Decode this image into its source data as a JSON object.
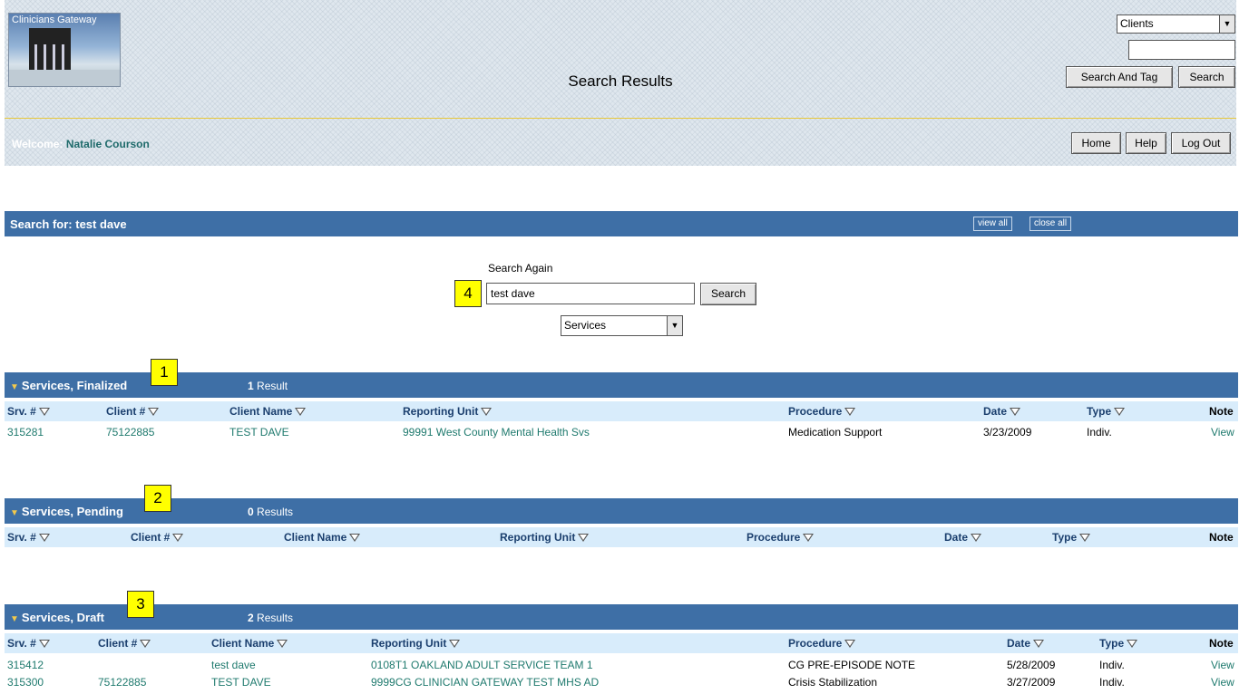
{
  "header": {
    "logo_text": "Clinicians Gateway",
    "page_title": "Search Results",
    "search_type_value": "Clients",
    "quick_search_value": "",
    "search_and_tag_label": "Search And Tag",
    "search_label": "Search",
    "welcome_label": "Welcome:",
    "user_name": "Natalie Courson",
    "home_label": "Home",
    "help_label": "Help",
    "logout_label": "Log Out"
  },
  "search_bar": {
    "title": "Search for: test dave",
    "view_all": "view all",
    "close_all": "close all"
  },
  "search_again": {
    "label": "Search Again",
    "value": "test dave",
    "button": "Search",
    "category": "Services"
  },
  "callouts": [
    "1",
    "2",
    "3",
    "4"
  ],
  "sections": [
    {
      "title": "Services, Finalized",
      "count": "1",
      "count_label": "Result",
      "columns": [
        "Srv. #",
        "Client #",
        "Client Name",
        "Reporting Unit",
        "Procedure",
        "Date",
        "Type",
        "Note"
      ],
      "rows": [
        [
          "315281",
          "75122885",
          "TEST DAVE",
          "99991 West County Mental Health Svs",
          "Medication Support",
          "3/23/2009",
          "Indiv.",
          "View"
        ]
      ]
    },
    {
      "title": "Services, Pending",
      "count": "0",
      "count_label": "Results",
      "columns": [
        "Srv. #",
        "Client #",
        "Client Name",
        "Reporting Unit",
        "Procedure",
        "Date",
        "Type",
        "Note"
      ],
      "rows": []
    },
    {
      "title": "Services, Draft",
      "count": "2",
      "count_label": "Results",
      "columns": [
        "Srv. #",
        "Client #",
        "Client Name",
        "Reporting Unit",
        "Procedure",
        "Date",
        "Type",
        "Note"
      ],
      "rows": [
        [
          "315412",
          "",
          "test dave",
          "0108T1 OAKLAND ADULT SERVICE TEAM 1",
          "CG PRE-EPISODE NOTE",
          "5/28/2009",
          "Indiv.",
          "View"
        ],
        [
          "315300",
          "75122885",
          "TEST DAVE",
          "9999CG CLINICIAN GATEWAY TEST MHS AD",
          "Crisis Stabilization",
          "3/27/2009",
          "Indiv.",
          "View"
        ]
      ]
    }
  ],
  "colors": {
    "bar_blue": "#3e6fa6",
    "header_row": "#d8ecfb",
    "link": "#1f7a6e",
    "callout": "#ffff00"
  }
}
